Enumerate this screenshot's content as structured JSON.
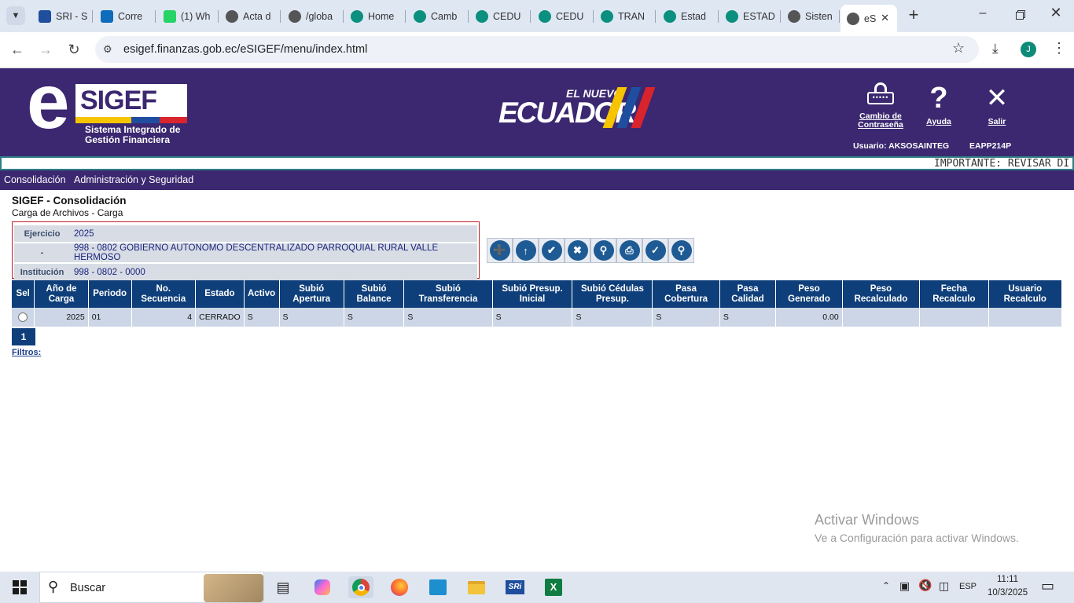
{
  "browser": {
    "tabs": [
      {
        "label": "SRI - S",
        "icon": "sri-icon",
        "color": "#1f4e9c"
      },
      {
        "label": "Corre",
        "icon": "outlook-icon",
        "color": "#0f6cbd"
      },
      {
        "label": "(1) Wh",
        "icon": "whatsapp-icon",
        "color": "#25d366"
      },
      {
        "label": "Acta d",
        "icon": "globe-icon",
        "color": "#555555"
      },
      {
        "label": "/globa",
        "icon": "globe-icon",
        "color": "#555555"
      },
      {
        "label": "Home",
        "icon": "gear-icon",
        "color": "#0b8f7e"
      },
      {
        "label": "Camb",
        "icon": "gear-icon",
        "color": "#0b8f7e"
      },
      {
        "label": "CEDU",
        "icon": "gear-icon",
        "color": "#0b8f7e"
      },
      {
        "label": "CEDU",
        "icon": "gear-icon",
        "color": "#0b8f7e"
      },
      {
        "label": "TRAN",
        "icon": "gear-icon",
        "color": "#0b8f7e"
      },
      {
        "label": "Estad",
        "icon": "gear-icon",
        "color": "#0b8f7e"
      },
      {
        "label": "ESTAD",
        "icon": "gear-icon",
        "color": "#0b8f7e"
      },
      {
        "label": "Sisten",
        "icon": "globe-icon",
        "color": "#555555"
      },
      {
        "label": "eS",
        "icon": "globe-icon",
        "color": "#555555",
        "active": true
      }
    ],
    "url": "esigef.finanzas.gob.ec/eSIGEF/menu/index.html",
    "profile_initial": "J"
  },
  "header": {
    "logo_e": "e",
    "logo_sigef": "SIGEF",
    "logo_line1": "Sistema Integrado de",
    "logo_line2": "Gestión Financiera",
    "center_small": "EL NUEVO",
    "center_big": "ECUADOR",
    "password_link": "Cambio de Contraseña",
    "help_link": "Ayuda",
    "exit_link": "Salir",
    "user_label": "Usuario: AKSOSAINTEG",
    "server_label": "EAPP214P",
    "ticker": "IMPORTANTE: REVISAR DI"
  },
  "menu": {
    "items": [
      "Consolidación",
      "Administración y Seguridad"
    ]
  },
  "page": {
    "title": "SIGEF - Consolidación",
    "subtitle": "Carga de Archivos - Carga",
    "info": {
      "ejercicio_label": "Ejercicio",
      "ejercicio_value": "2025",
      "dash_label": "-",
      "entity_value": "998 - 0802 GOBIERNO AUTONOMO DESCENTRALIZADO PARROQUIAL RURAL VALLE HERMOSO",
      "institucion_label": "Institución",
      "institucion_value": "998 - 0802 - 0000"
    },
    "toolbar_icons": [
      "new-document-icon",
      "upload-icon",
      "validate-grid-icon",
      "delete-icon",
      "search-document-icon",
      "print-icon",
      "approve-icon",
      "search-icon"
    ],
    "table": {
      "headers": [
        "Sel",
        "Año de Carga",
        "Periodo",
        "No. Secuencia",
        "Estado",
        "Activo",
        "Subió Apertura",
        "Subió Balance",
        "Subió Transferencia",
        "Subió Presup. Inicial",
        "Subió Cédulas Presup.",
        "Pasa Cobertura",
        "Pasa Calidad",
        "Peso Generado",
        "Peso Recalculado",
        "Fecha Recalculo",
        "Usuario Recalculo"
      ],
      "rows": [
        [
          "",
          "2025",
          "01",
          "4",
          "CERRADO",
          "S",
          "S",
          "S",
          "S",
          "S",
          "S",
          "S",
          "S",
          "0.00",
          "",
          "",
          ""
        ]
      ]
    },
    "pager_page": "1",
    "filters_link": "Filtros:"
  },
  "watermark": {
    "line1": "Activar Windows",
    "line2": "Ve a Configuración para activar Windows."
  },
  "taskbar": {
    "search_placeholder": "Buscar",
    "lang": "ESP",
    "time": "11:11",
    "date": "10/3/2025"
  }
}
